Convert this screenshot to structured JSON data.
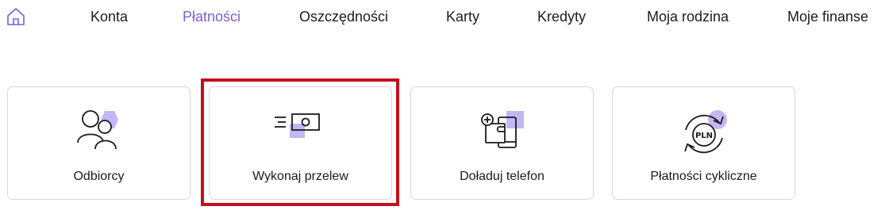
{
  "nav": {
    "home_icon": "home-icon",
    "items": [
      {
        "label": "Konta"
      },
      {
        "label": "Płatności",
        "active": true
      },
      {
        "label": "Oszczędności"
      },
      {
        "label": "Karty"
      },
      {
        "label": "Kredyty"
      },
      {
        "label": "Moja rodzina"
      },
      {
        "label": "Moje finanse"
      }
    ]
  },
  "tiles": [
    {
      "label": "Odbiorcy",
      "icon": "recipients-icon"
    },
    {
      "label": "Wykonaj przelew",
      "icon": "transfer-money-icon",
      "highlighted": true
    },
    {
      "label": "Doładuj telefon",
      "icon": "phone-topup-icon"
    },
    {
      "label": "Płatności cykliczne",
      "icon": "recurring-payment-icon",
      "icon_text": "PLN"
    }
  ],
  "colors": {
    "accent": "#7a5fd0",
    "accent_light": "#c3b6f4",
    "highlight_border": "#c4101c"
  }
}
